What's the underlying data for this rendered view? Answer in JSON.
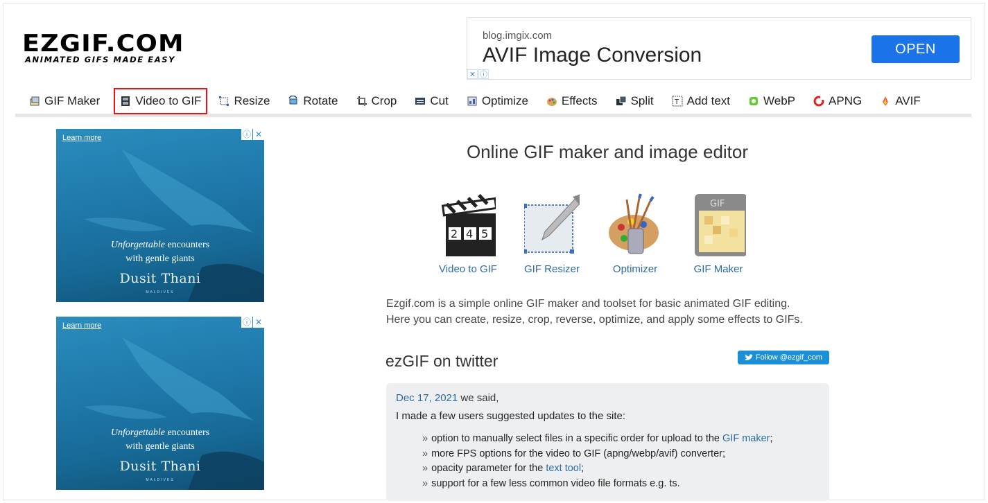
{
  "logo": {
    "main": "EZGIF.COM",
    "tagline": "ANIMATED GIFS MADE EASY"
  },
  "top_ad": {
    "domain": "blog.imgix.com",
    "title": "AVIF Image Conversion",
    "button": "OPEN"
  },
  "nav": {
    "items": [
      {
        "label": "GIF Maker",
        "icon": "gif-maker-icon"
      },
      {
        "label": "Video to GIF",
        "icon": "film-icon",
        "selected": true
      },
      {
        "label": "Resize",
        "icon": "resize-icon"
      },
      {
        "label": "Rotate",
        "icon": "rotate-icon"
      },
      {
        "label": "Crop",
        "icon": "crop-icon"
      },
      {
        "label": "Cut",
        "icon": "cut-icon"
      },
      {
        "label": "Optimize",
        "icon": "optimize-icon"
      },
      {
        "label": "Effects",
        "icon": "palette-icon"
      },
      {
        "label": "Split",
        "icon": "split-icon"
      },
      {
        "label": "Add text",
        "icon": "text-icon"
      },
      {
        "label": "WebP",
        "icon": "webp-icon"
      },
      {
        "label": "APNG",
        "icon": "apng-icon"
      },
      {
        "label": "AVIF",
        "icon": "avif-icon"
      }
    ]
  },
  "side_ad": {
    "learn_more": "Learn more",
    "line1_em": "Unforgettable",
    "line1_rest": " encounters",
    "line2": "with gentle giants",
    "brand": "Dusit Thani",
    "sub": "MALDIVES"
  },
  "main": {
    "headline": "Online GIF maker and image editor",
    "tools": [
      {
        "label": "Video to GIF"
      },
      {
        "label": "GIF Resizer"
      },
      {
        "label": "Optimizer"
      },
      {
        "label": "GIF Maker"
      }
    ],
    "intro_1": "Ezgif.com is a simple online GIF maker and toolset for basic animated GIF editing.",
    "intro_2": "Here you can create, resize, crop, reverse, optimize, and apply some effects to GIFs."
  },
  "twitter": {
    "heading": "ezGIF on twitter",
    "follow": "Follow @ezgif_com",
    "tweet": {
      "date": "Dec 17, 2021",
      "said": " we said,",
      "line": "I made a few users suggested updates to the site:",
      "items": [
        {
          "pre": "option to manually select files in a specific order for upload to the ",
          "link": "GIF maker",
          "post": ";"
        },
        {
          "pre": "more FPS options for the video to GIF (apng/webp/avif) converter;",
          "link": "",
          "post": ""
        },
        {
          "pre": "opacity parameter for the ",
          "link": "text tool",
          "post": ";"
        },
        {
          "pre": "support for a few less common video file formats e.g. ts.",
          "link": "",
          "post": ""
        }
      ]
    }
  },
  "colors": {
    "link": "#2b6aa6",
    "open_button": "#1a73e8",
    "selected_outline": "#e11111",
    "follow": "#1d8fd8"
  }
}
